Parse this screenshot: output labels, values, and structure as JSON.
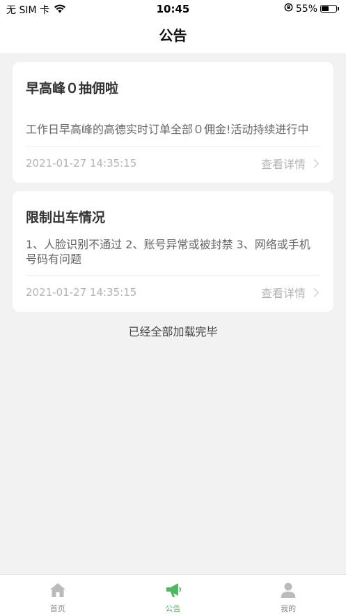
{
  "status_bar": {
    "carrier": "无 SIM 卡",
    "time": "10:45",
    "battery_percent": "55%",
    "battery_level": 0.55
  },
  "nav": {
    "title": "公告"
  },
  "notices": [
    {
      "title": "早高峰０抽佣啦",
      "summary": "工作日早高峰的高德实时订单全部０佣金!活动持续进行中",
      "date": "2021-01-27 14:35:15",
      "link_label": "查看详情"
    },
    {
      "title": "限制出车情况",
      "summary": "1、人脸识别不通过 2、账号异常或被封禁  3、网络或手机号码有问题",
      "date": "2021-01-27 14:35:15",
      "link_label": "查看详情"
    }
  ],
  "list_end_text": "已经全部加载完毕",
  "tabs": [
    {
      "label": "首页",
      "icon": "home-icon",
      "active": false
    },
    {
      "label": "公告",
      "icon": "megaphone-icon",
      "active": true
    },
    {
      "label": "我的",
      "icon": "person-icon",
      "active": false
    }
  ],
  "colors": {
    "accent": "#4cb860",
    "inactive": "#bbbbbb",
    "background": "#f2f2f2"
  }
}
